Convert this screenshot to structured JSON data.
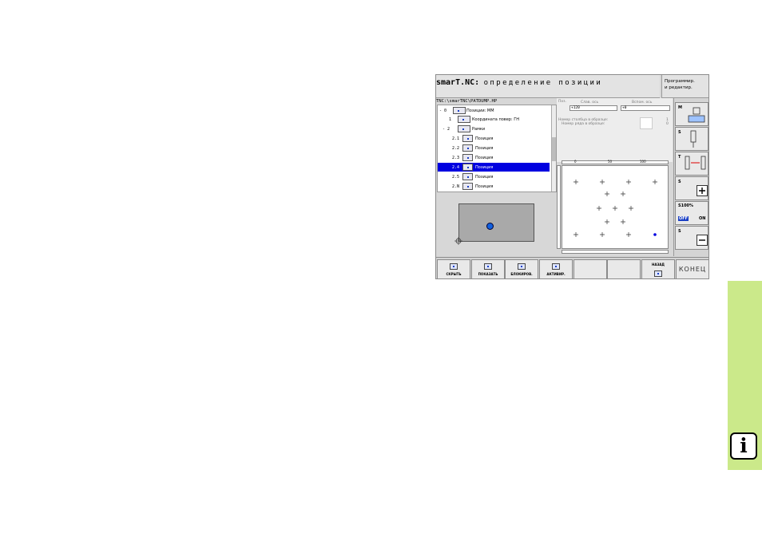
{
  "app": {
    "brand": "smarT.NC:",
    "title": "определение позиции",
    "mode_line1": "Программир.",
    "mode_line2": "и редактир."
  },
  "path": "TNC:\\smarTNC\\PATDUMP.HP",
  "tree": {
    "rows": [
      {
        "num": "- 0",
        "label": "Позиции: ММ"
      },
      {
        "num": "1",
        "label": "Координата повер:    ГН"
      },
      {
        "num": "- 2",
        "label": "Рамки"
      },
      {
        "num": "2.1",
        "label": "Позиция"
      },
      {
        "num": "2.2",
        "label": "Позиция"
      },
      {
        "num": "2.3",
        "label": "Позиция"
      },
      {
        "num": "2.4",
        "label": "Позиция"
      },
      {
        "num": "2.5",
        "label": "Позиция"
      },
      {
        "num": "2.N",
        "label": "Позиция"
      }
    ],
    "selected_index": 6
  },
  "form": {
    "pos_label": "Поз.",
    "col1_label": "Слав. ось",
    "col2_label": "Вспом. ось",
    "x_value": "+120",
    "y_value": "+0",
    "row1_label": "Номер столбца в образце:",
    "row1_value": "1",
    "row2_label": "Номер ряда в образце:",
    "row2_value": "0"
  },
  "ruler": {
    "t1": "0",
    "t2": "50",
    "t3": "100"
  },
  "side": {
    "b1": "M",
    "b2": "S",
    "b3": "T",
    "b4": "S",
    "b5_top": "S100%",
    "b5_off": "OFF",
    "b5_on": "ON",
    "b6": "S"
  },
  "softkeys": [
    {
      "label": "СКРЫТЬ"
    },
    {
      "label": "ПОКАЗАТЬ"
    },
    {
      "label": "БЛОКИРОВ."
    },
    {
      "label": "АКТИВИР."
    },
    {
      "label": ""
    },
    {
      "label": ""
    },
    {
      "label": "НАЗАД"
    }
  ],
  "end_label": "КОНЕЦ",
  "info_glyph": "i",
  "colors": {
    "selection": "#0000e0",
    "accent_blue": "#1060e0",
    "info_tab": "#cbe98a"
  }
}
